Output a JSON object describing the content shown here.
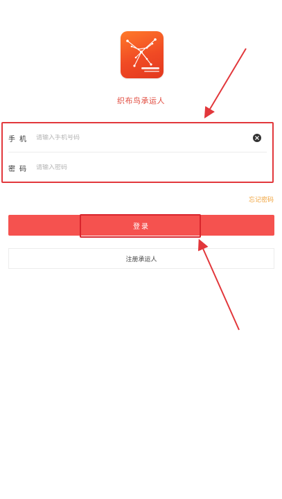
{
  "app": {
    "name": "织布鸟承运人"
  },
  "login_form": {
    "phone_label": "手机",
    "phone_placeholder": "请输入手机号码",
    "password_label": "密码",
    "password_placeholder": "请输入密码"
  },
  "actions": {
    "forgot_password": "忘记密码",
    "login": "登录",
    "register": "注册承运人"
  },
  "colors": {
    "brand": "#f5524f",
    "accent_link": "#f0a33c",
    "annotation": "#e2373b"
  },
  "icons": {
    "clear": "clear-icon",
    "logo": "bird-logo-icon"
  }
}
